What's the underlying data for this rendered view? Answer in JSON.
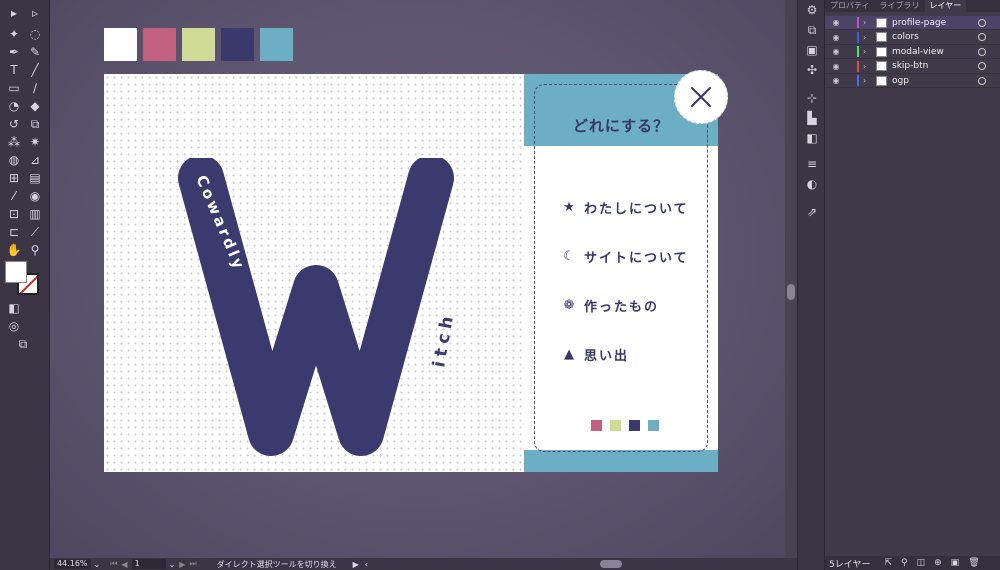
{
  "tools": [
    {
      "icon": "selection-arrow-icon",
      "glyph": "▸"
    },
    {
      "icon": "direct-selection-icon",
      "glyph": "▹"
    },
    {
      "icon": "magic-wand-icon",
      "glyph": "✦"
    },
    {
      "icon": "lasso-icon",
      "glyph": "◌"
    },
    {
      "icon": "pen-icon",
      "glyph": "✒"
    },
    {
      "icon": "curvature-icon",
      "glyph": "✎"
    },
    {
      "icon": "type-icon",
      "glyph": "T"
    },
    {
      "icon": "line-icon",
      "glyph": "╱"
    },
    {
      "icon": "rectangle-icon",
      "glyph": "▭"
    },
    {
      "icon": "paintbrush-icon",
      "glyph": "∕"
    },
    {
      "icon": "shaper-icon",
      "glyph": "◔"
    },
    {
      "icon": "eraser-icon",
      "glyph": "◆"
    },
    {
      "icon": "rotate-icon",
      "glyph": "↺"
    },
    {
      "icon": "scale-icon",
      "glyph": "⧉"
    },
    {
      "icon": "warp-icon",
      "glyph": "⁂"
    },
    {
      "icon": "puppet-warp-icon",
      "glyph": "✷"
    },
    {
      "icon": "shape-builder-icon",
      "glyph": "◍"
    },
    {
      "icon": "perspective-grid-icon",
      "glyph": "⊿"
    },
    {
      "icon": "mesh-icon",
      "glyph": "⊞"
    },
    {
      "icon": "gradient-icon",
      "glyph": "▤"
    },
    {
      "icon": "eyedropper-icon",
      "glyph": "⁄"
    },
    {
      "icon": "blend-icon",
      "glyph": "◉"
    },
    {
      "icon": "symbol-sprayer-icon",
      "glyph": "⊡"
    },
    {
      "icon": "graph-icon",
      "glyph": "▥"
    },
    {
      "icon": "artboard-icon",
      "glyph": "⊏"
    },
    {
      "icon": "slice-icon",
      "glyph": "⟋"
    },
    {
      "icon": "hand-icon",
      "glyph": "✋"
    },
    {
      "icon": "zoom-icon",
      "glyph": "⚲"
    }
  ],
  "canvas_colors": [
    "#ffffff",
    "#c2617f",
    "#cfdb95",
    "#39396b",
    "#6caec3"
  ],
  "artwork": {
    "big_letter": "W",
    "arc_word": "Cowardly",
    "side_word": "itch",
    "accent": "#3b3a6e"
  },
  "modal": {
    "title": "どれにする？",
    "items": [
      {
        "icon": "star-icon",
        "glyph": "★",
        "label": "わたしについて"
      },
      {
        "icon": "moon-icon",
        "glyph": "☾",
        "label": "サイトについて"
      },
      {
        "icon": "paw-icon",
        "glyph": "❁",
        "label": "作ったもの"
      },
      {
        "icon": "mountain-icon",
        "glyph": "▲",
        "label": "思い出"
      }
    ],
    "mini_colors": [
      "#c2617f",
      "#cfdb95",
      "#39396b",
      "#6caec3"
    ],
    "close_glyph": "✕"
  },
  "right_icons": [
    {
      "icon": "properties-icon",
      "glyph": "⚙"
    },
    {
      "icon": "artboards-icon",
      "glyph": "⧉"
    },
    {
      "icon": "libraries-icon",
      "glyph": "▣"
    },
    {
      "icon": "puppet-icon",
      "glyph": "✣"
    },
    {
      "icon": "transform-icon",
      "glyph": "⊹"
    },
    {
      "icon": "align-icon",
      "glyph": "▙"
    },
    {
      "icon": "pathfinder-icon",
      "glyph": "◧"
    },
    {
      "icon": "stroke-icon",
      "glyph": "≡"
    },
    {
      "icon": "transparency-icon",
      "glyph": "◐"
    },
    {
      "icon": "export-icon",
      "glyph": "⇗"
    }
  ],
  "layers_panel": {
    "tabs": [
      "プロパティ",
      "ライブラリ",
      "レイヤー"
    ],
    "active_tab": 2,
    "layers": [
      {
        "name": "profile-page",
        "color": "#c04ed8",
        "selected": true
      },
      {
        "name": "colors",
        "color": "#4d58e0",
        "selected": false
      },
      {
        "name": "modal-view",
        "color": "#4fe06a",
        "selected": false
      },
      {
        "name": "skip-btn",
        "color": "#e04a4a",
        "selected": false
      },
      {
        "name": "ogp",
        "color": "#4a6ae0",
        "selected": false
      }
    ],
    "footer_count": "5レイヤー"
  },
  "statusbar": {
    "zoom": "44.16%",
    "artboard_number": "1",
    "tool_hint": "ダイレクト選択ツールを切り換え"
  }
}
